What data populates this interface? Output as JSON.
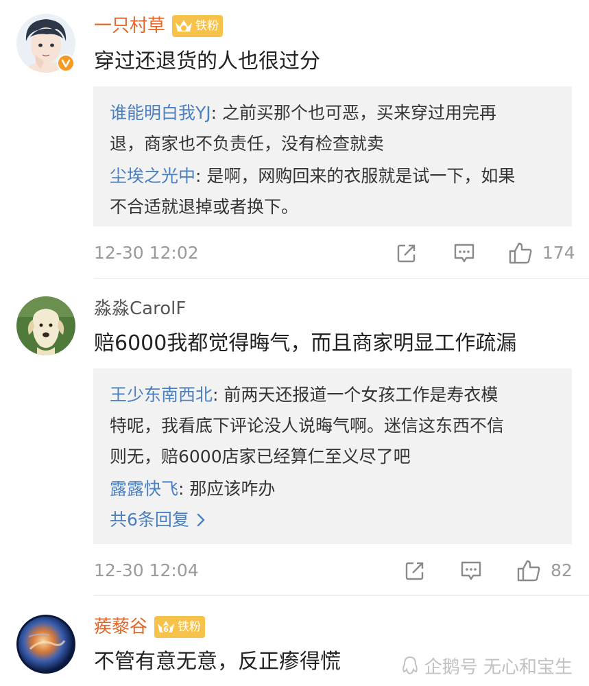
{
  "comments": [
    {
      "author": "一只村草",
      "badge": "铁粉",
      "text": "穿过还退货的人也很过分",
      "replies": [
        {
          "author": "谁能明白我YJ",
          "text": ": 之前买那个也可恶，买来穿过用完再",
          "cont": "退，商家也不负责任，没有检查就卖"
        },
        {
          "author": "尘埃之光中",
          "text": ": 是啊，网购回来的衣服就是试一下，如果",
          "cont": "不合适就退掉或者换下。"
        }
      ],
      "time": "12-30 12:02",
      "likes": "174"
    },
    {
      "author": "淼淼CarolF",
      "text": "赔6000我都觉得晦气，而且商家明显工作疏漏",
      "replies": [
        {
          "author": "王少东南西北",
          "text": ": 前两天还报道一个女孩工作是寿衣模",
          "cont": "特呢，我看底下评论没人说晦气啊。迷信这东西不信",
          "cont2": "则无，赔6000店家已经算仁至义尽了吧"
        },
        {
          "author": "露露快飞",
          "text": ": 那应该咋办"
        }
      ],
      "more": "共6条回复",
      "time": "12-30 12:04",
      "likes": "82"
    },
    {
      "author": "蒺藜谷",
      "badge": "铁粉",
      "text": "不管有意无意，反正瘆得慌"
    }
  ],
  "badge_level": "6",
  "watermark": "企鹅号 无心和宝生",
  "icons": {
    "share": "share-icon",
    "comment": "comment-icon",
    "like": "thumbs-up-icon",
    "verified": "verified-badge-icon",
    "crown": "crown-icon",
    "chevron": "chevron-right-icon",
    "penguin": "penguin-icon"
  },
  "colors": {
    "author_orange": "#e0662a",
    "reply_author_blue": "#4a7fc1",
    "reply_box_bg": "#f2f2f2",
    "meta_gray": "#9a9a9a",
    "badge_gold": "#f7c24a"
  }
}
